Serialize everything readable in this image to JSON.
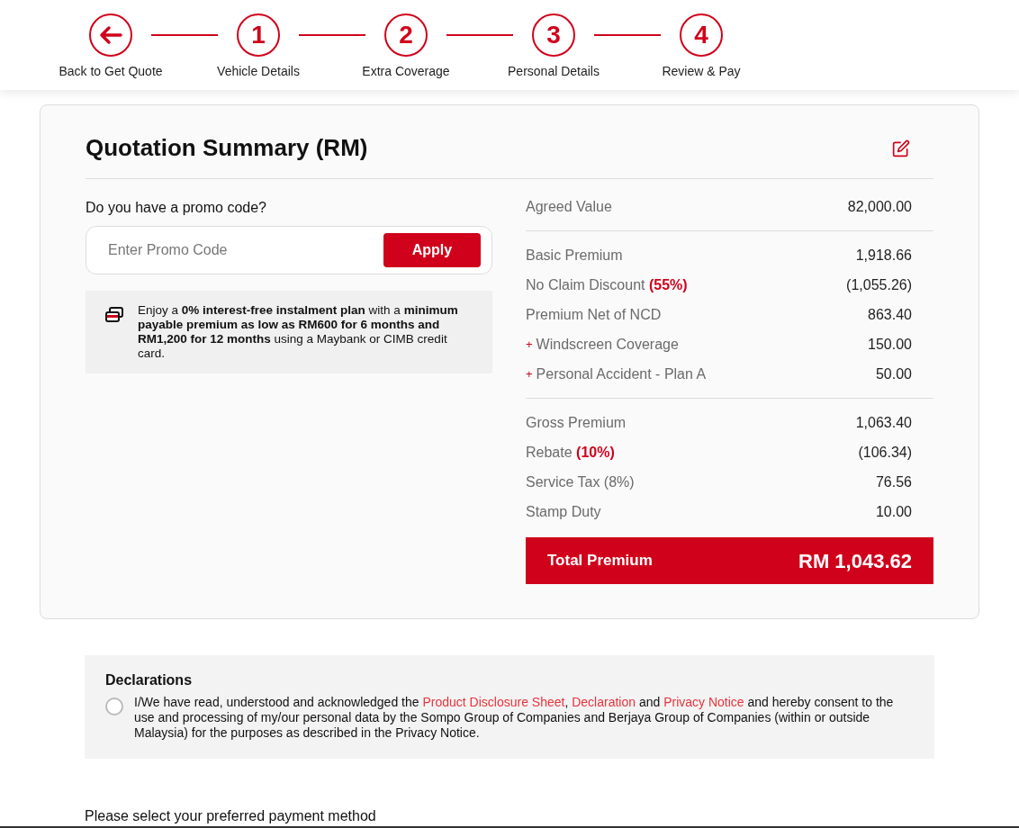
{
  "stepper": [
    {
      "kind": "back",
      "label": "Back to Get Quote"
    },
    {
      "kind": "number",
      "glyph": "1",
      "label": "Vehicle Details"
    },
    {
      "kind": "number",
      "glyph": "2",
      "label": "Extra Coverage"
    },
    {
      "kind": "number",
      "glyph": "3",
      "label": "Personal Details"
    },
    {
      "kind": "number",
      "glyph": "4",
      "label": "Review & Pay"
    }
  ],
  "summary": {
    "title": "Quotation Summary (RM)",
    "promo": {
      "question": "Do you have a promo code?",
      "placeholder": "Enter Promo Code",
      "button": "Apply"
    },
    "instalment_note": "Enjoy a **0% interest-free instalment plan** with a **minimum payable premium as low as RM600 for 6 months and RM1,200 for 12 months** using a Maybank or CIMB credit card.",
    "groups": [
      [
        {
          "kind": "plain",
          "label": "Agreed Value",
          "value": "82,000.00"
        }
      ],
      [
        {
          "kind": "plain",
          "label": "Basic Premium",
          "value": "1,918.66"
        },
        {
          "kind": "plain",
          "label": "No Claim Discount **(55%)**",
          "value": "(1,055.26)"
        },
        {
          "kind": "plain",
          "label": "Premium Net of NCD",
          "value": "863.40"
        },
        {
          "kind": "addon",
          "marker": "+",
          "label": "Windscreen Coverage",
          "value": "150.00"
        },
        {
          "kind": "addon",
          "marker": "+",
          "label": "Personal Accident - Plan A",
          "value": "50.00"
        }
      ],
      [
        {
          "kind": "plain",
          "label": "Gross Premium",
          "value": "1,063.40"
        },
        {
          "kind": "plain",
          "label": "Rebate **(10%)**",
          "value": "(106.34)"
        },
        {
          "kind": "plain",
          "label": "Service Tax (8%)",
          "value": "76.56"
        },
        {
          "kind": "plain",
          "label": "Stamp Duty",
          "value": "10.00"
        }
      ]
    ],
    "total": {
      "label": "Total Premium",
      "value": "RM 1,043.62"
    }
  },
  "declarations": {
    "title": "Declarations",
    "checked": false,
    "text": [
      {
        "kind": "text",
        "text": "I/We have read, understood and acknowledged the "
      },
      {
        "kind": "link",
        "text": "Product Disclosure Sheet"
      },
      {
        "kind": "text",
        "text": ", "
      },
      {
        "kind": "link",
        "text": "Declaration"
      },
      {
        "kind": "text",
        "text": " and "
      },
      {
        "kind": "link",
        "text": "Privacy Notice"
      },
      {
        "kind": "text",
        "text": " and hereby consent to the use and processing of my/our personal data by the Sompo Group of Companies and Berjaya Group of Companies (within or outside Malaysia) for the purposes as described in the Privacy Notice."
      }
    ]
  },
  "payment_prompt": "Please select your preferred payment method"
}
